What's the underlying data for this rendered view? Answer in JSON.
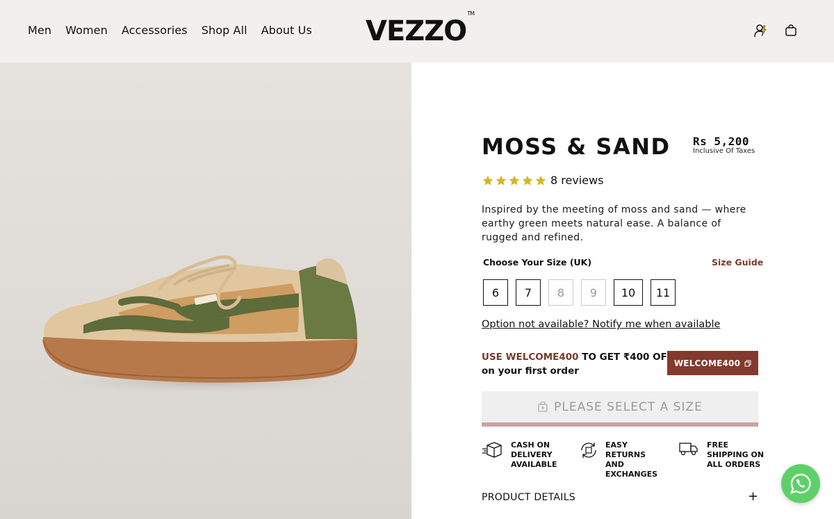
{
  "nav": {
    "items": [
      "Men",
      "Women",
      "Accessories",
      "Shop All",
      "About Us"
    ]
  },
  "brand": {
    "name": "VEZZO",
    "tm": "TM"
  },
  "header_icons": [
    "user-icon",
    "bag-icon"
  ],
  "product": {
    "title": "MOSS & SAND",
    "price": "Rs 5,200",
    "tax_note": "Inclusive Of Taxes",
    "rating": 5,
    "reviews": "8 reviews",
    "description": "Inspired by the meeting of moss and sand — where earthy green meets natural ease. A balance of rugged and refined."
  },
  "sizes": {
    "label": "Choose Your Size (UK)",
    "guide": "Size Guide",
    "options": [
      {
        "label": "6",
        "available": true
      },
      {
        "label": "7",
        "available": true
      },
      {
        "label": "8",
        "available": false
      },
      {
        "label": "9",
        "available": false
      },
      {
        "label": "10",
        "available": true
      },
      {
        "label": "11",
        "available": true
      }
    ],
    "notify": "Option not available? Notify me when available"
  },
  "promo": {
    "prefix": "USE ",
    "code": "WELCOME400",
    "suffix": " TO GET ₹400 OFF",
    "line2": "on your first order",
    "button": "WELCOME400"
  },
  "cta": {
    "label": "PLEASE SELECT A SIZE"
  },
  "features": [
    {
      "icon": "box-icon",
      "text": "CASH ON DELIVERY AVAILABLE"
    },
    {
      "icon": "returns-icon",
      "text": "EASY RETURNS AND EXCHANGES"
    },
    {
      "icon": "truck-icon",
      "text": "FREE SHIPPING ON ALL ORDERS"
    }
  ],
  "details": {
    "label": "PRODUCT DETAILS",
    "toggle": "+"
  },
  "colors": {
    "accent": "#84392e",
    "star": "#d4b62a",
    "whatsapp": "#5fd069",
    "header_bg": "#f4efef"
  }
}
